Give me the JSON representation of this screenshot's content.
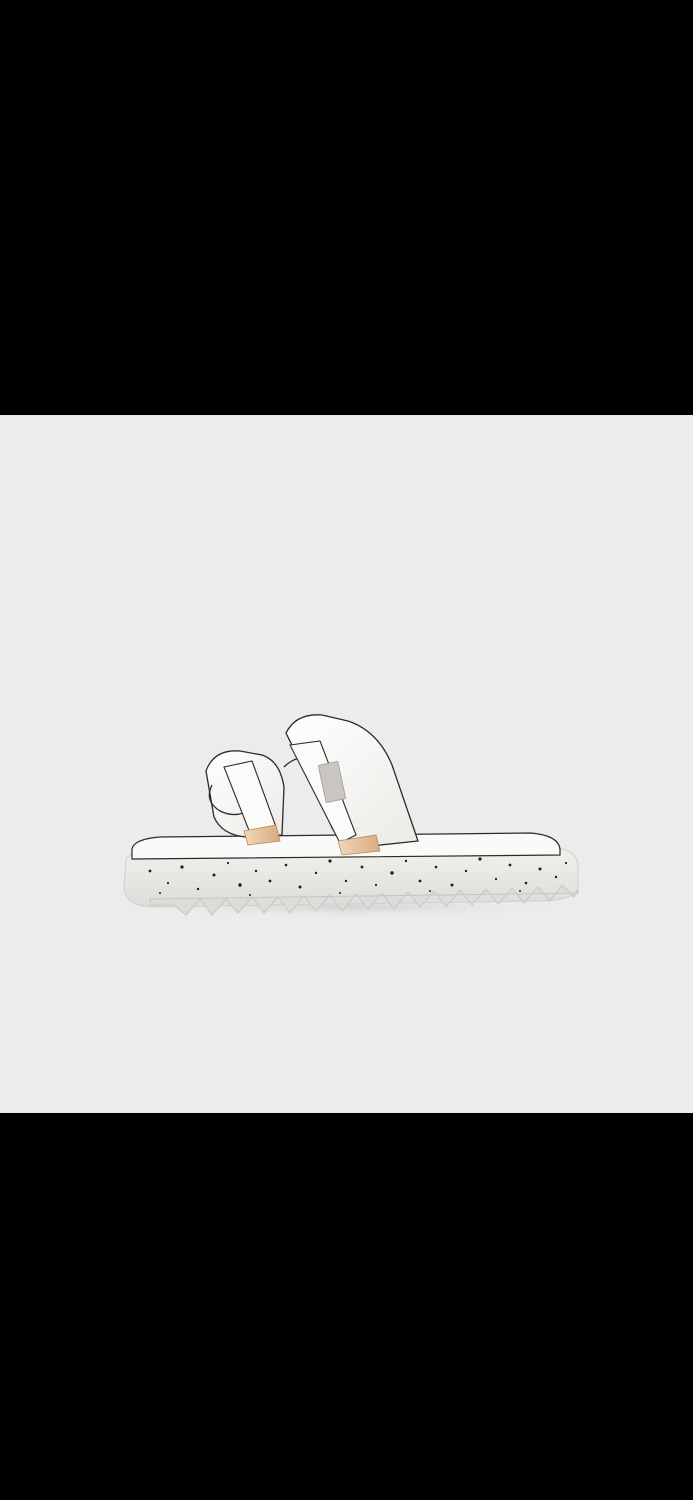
{
  "viewer": {
    "background_color": "#000000",
    "photo_background_color": "#ececec"
  },
  "photo": {
    "subject": "sandal",
    "colors": {
      "leather": "#f7f6f3",
      "piping": "#2b2b2b",
      "sole": "#e7e7e3",
      "speckle": "#1f1f1f",
      "tip": "#e9c7a4",
      "label": "#c9c5c1"
    }
  }
}
